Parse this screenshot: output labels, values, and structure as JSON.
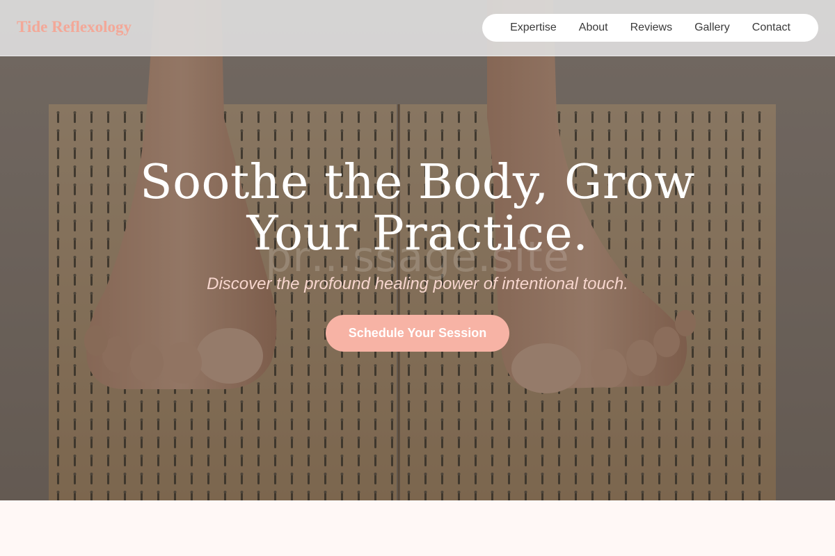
{
  "header": {
    "brand": "Tide Reflexology",
    "nav": [
      {
        "label": "Expertise"
      },
      {
        "label": "About"
      },
      {
        "label": "Reviews"
      },
      {
        "label": "Gallery"
      },
      {
        "label": "Contact"
      }
    ]
  },
  "hero": {
    "title_line1": "Soothe the Body, Grow",
    "title_line2": "Your Practice.",
    "subtitle": "Discover the profound healing power of intentional touch.",
    "cta_label": "Schedule Your Session",
    "watermark": "pr…ssage.site"
  },
  "colors": {
    "brand": "#f3a898",
    "accent": "#f7b3a5",
    "subtitle": "#f7d6ce",
    "page_background": "#fff8f6"
  }
}
